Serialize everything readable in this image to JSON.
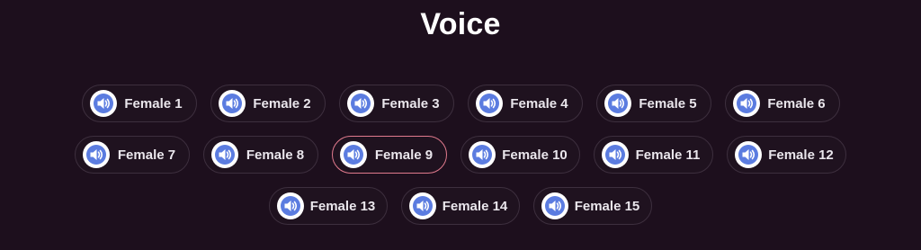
{
  "title": "Voice",
  "accent_color": "#e07a8d",
  "icon": "speaker-icon",
  "voices": [
    {
      "label": "Female 1"
    },
    {
      "label": "Female 2"
    },
    {
      "label": "Female 3"
    },
    {
      "label": "Female 4"
    },
    {
      "label": "Female 5"
    },
    {
      "label": "Female 6"
    },
    {
      "label": "Female 7"
    },
    {
      "label": "Female 8"
    },
    {
      "label": "Female 9",
      "selected": true
    },
    {
      "label": "Female 10"
    },
    {
      "label": "Female 11"
    },
    {
      "label": "Female 12"
    },
    {
      "label": "Female 13"
    },
    {
      "label": "Female 14"
    },
    {
      "label": "Female 15"
    }
  ]
}
